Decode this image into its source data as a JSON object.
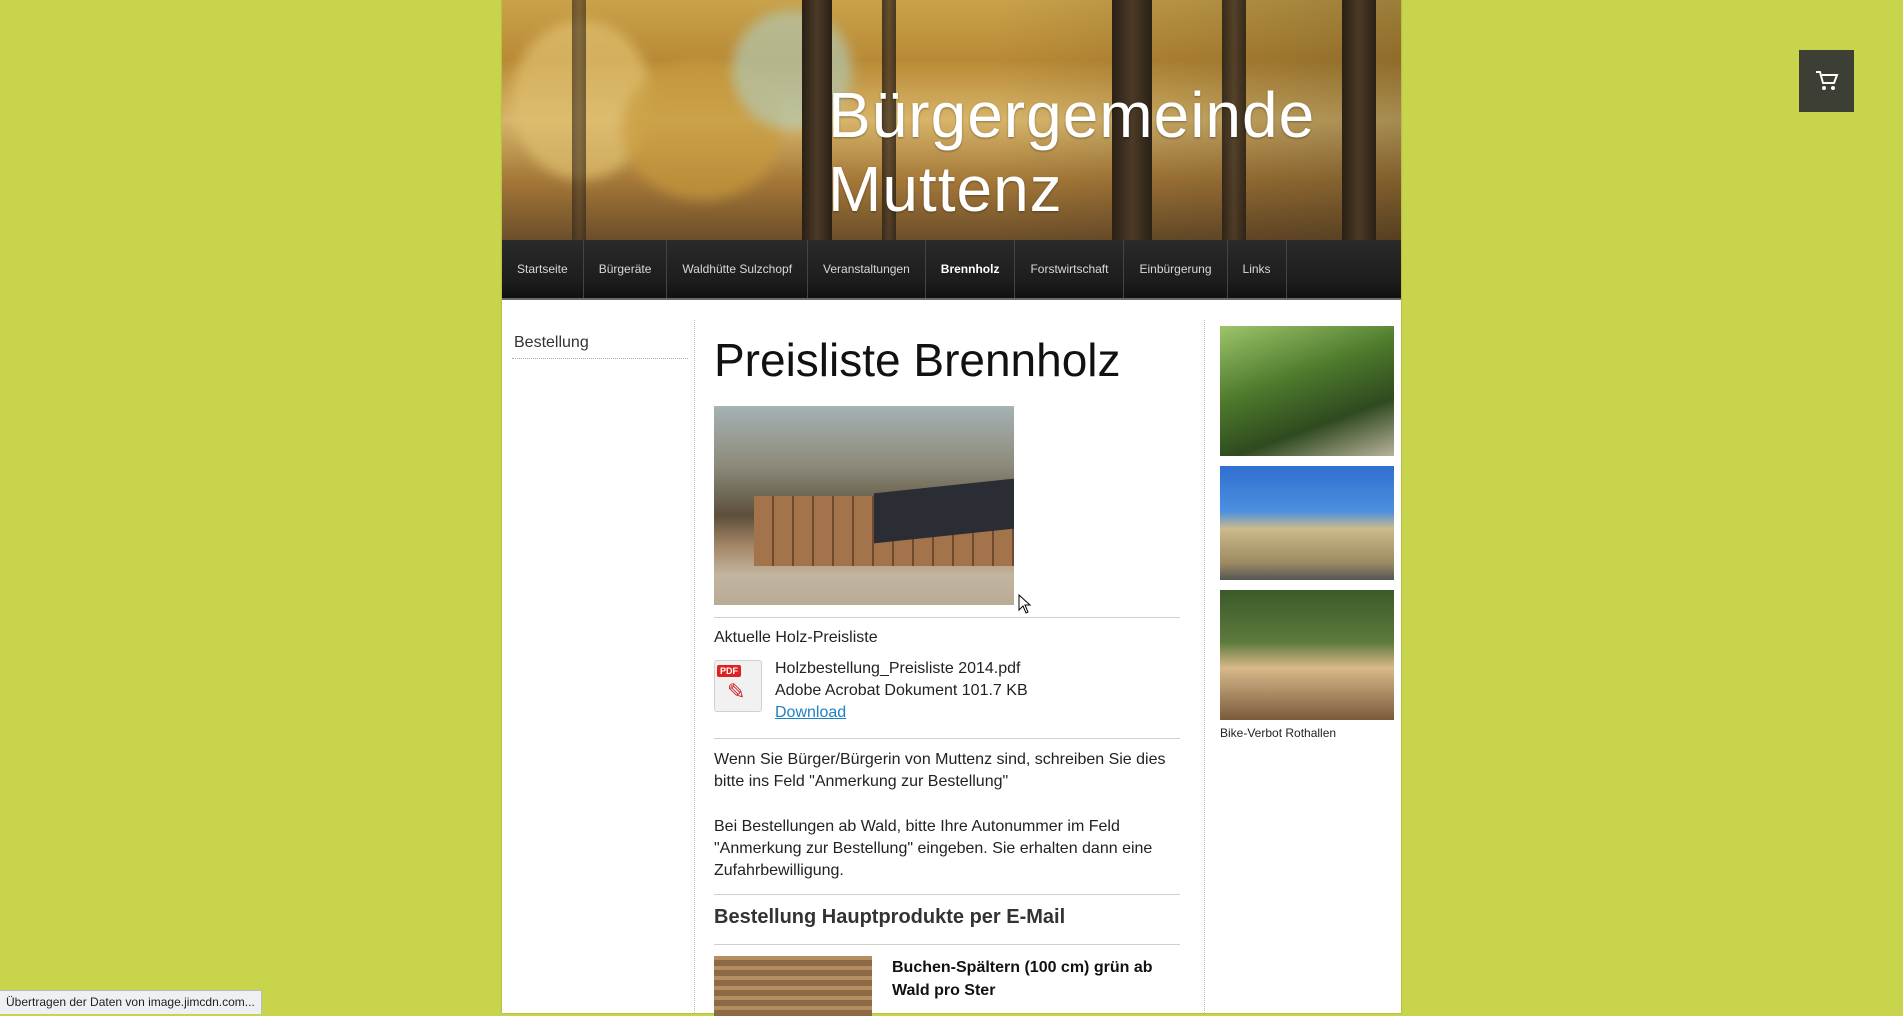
{
  "site": {
    "title": "Bürgergemeinde\nMuttenz"
  },
  "nav": {
    "items": [
      {
        "label": "Startseite"
      },
      {
        "label": "Bürgeräte"
      },
      {
        "label": "Waldhütte Sulzchopf"
      },
      {
        "label": "Veranstaltungen"
      },
      {
        "label": "Brennholz",
        "active": true
      },
      {
        "label": "Forstwirtschaft"
      },
      {
        "label": "Einbürgerung"
      },
      {
        "label": "Links"
      }
    ]
  },
  "subnav": {
    "items": [
      {
        "label": "Bestellung"
      }
    ]
  },
  "main": {
    "heading": "Preisliste Brennholz",
    "section_label": "Aktuelle Holz-Preisliste",
    "download": {
      "icon": "pdf-icon",
      "badge": "PDF",
      "filename": "Holzbestellung_Preisliste 2014.pdf",
      "meta": "Adobe Acrobat Dokument 101.7 KB",
      "link_label": "Download"
    },
    "para1": "Wenn Sie Bürger/Bürgerin von Muttenz sind, schreiben Sie dies bitte ins Feld \"Anmerkung zur Bestellung\"",
    "para2": "Bei Bestellungen ab Wald, bitte Ihre Autonummer im Feld \"Anmerkung zur Bestellung\" eingeben. Sie erhalten dann eine Zufahrbewilligung.",
    "subheading": "Bestellung Hauptprodukte per E-Mail",
    "product_title": "Buchen-Spältern (100 cm) grün ab Wald pro Ster"
  },
  "sidebar": {
    "caption": "Bike-Verbot Rothallen"
  },
  "cart": {
    "icon": "shopping-cart-icon"
  },
  "statusbar": {
    "text": "Übertragen der Daten von image.jimcdn.com..."
  },
  "colors": {
    "background": "#c8d44c",
    "nav": "#1d1d1d",
    "link": "#1f7fc4",
    "cart": "#3d3f34"
  }
}
